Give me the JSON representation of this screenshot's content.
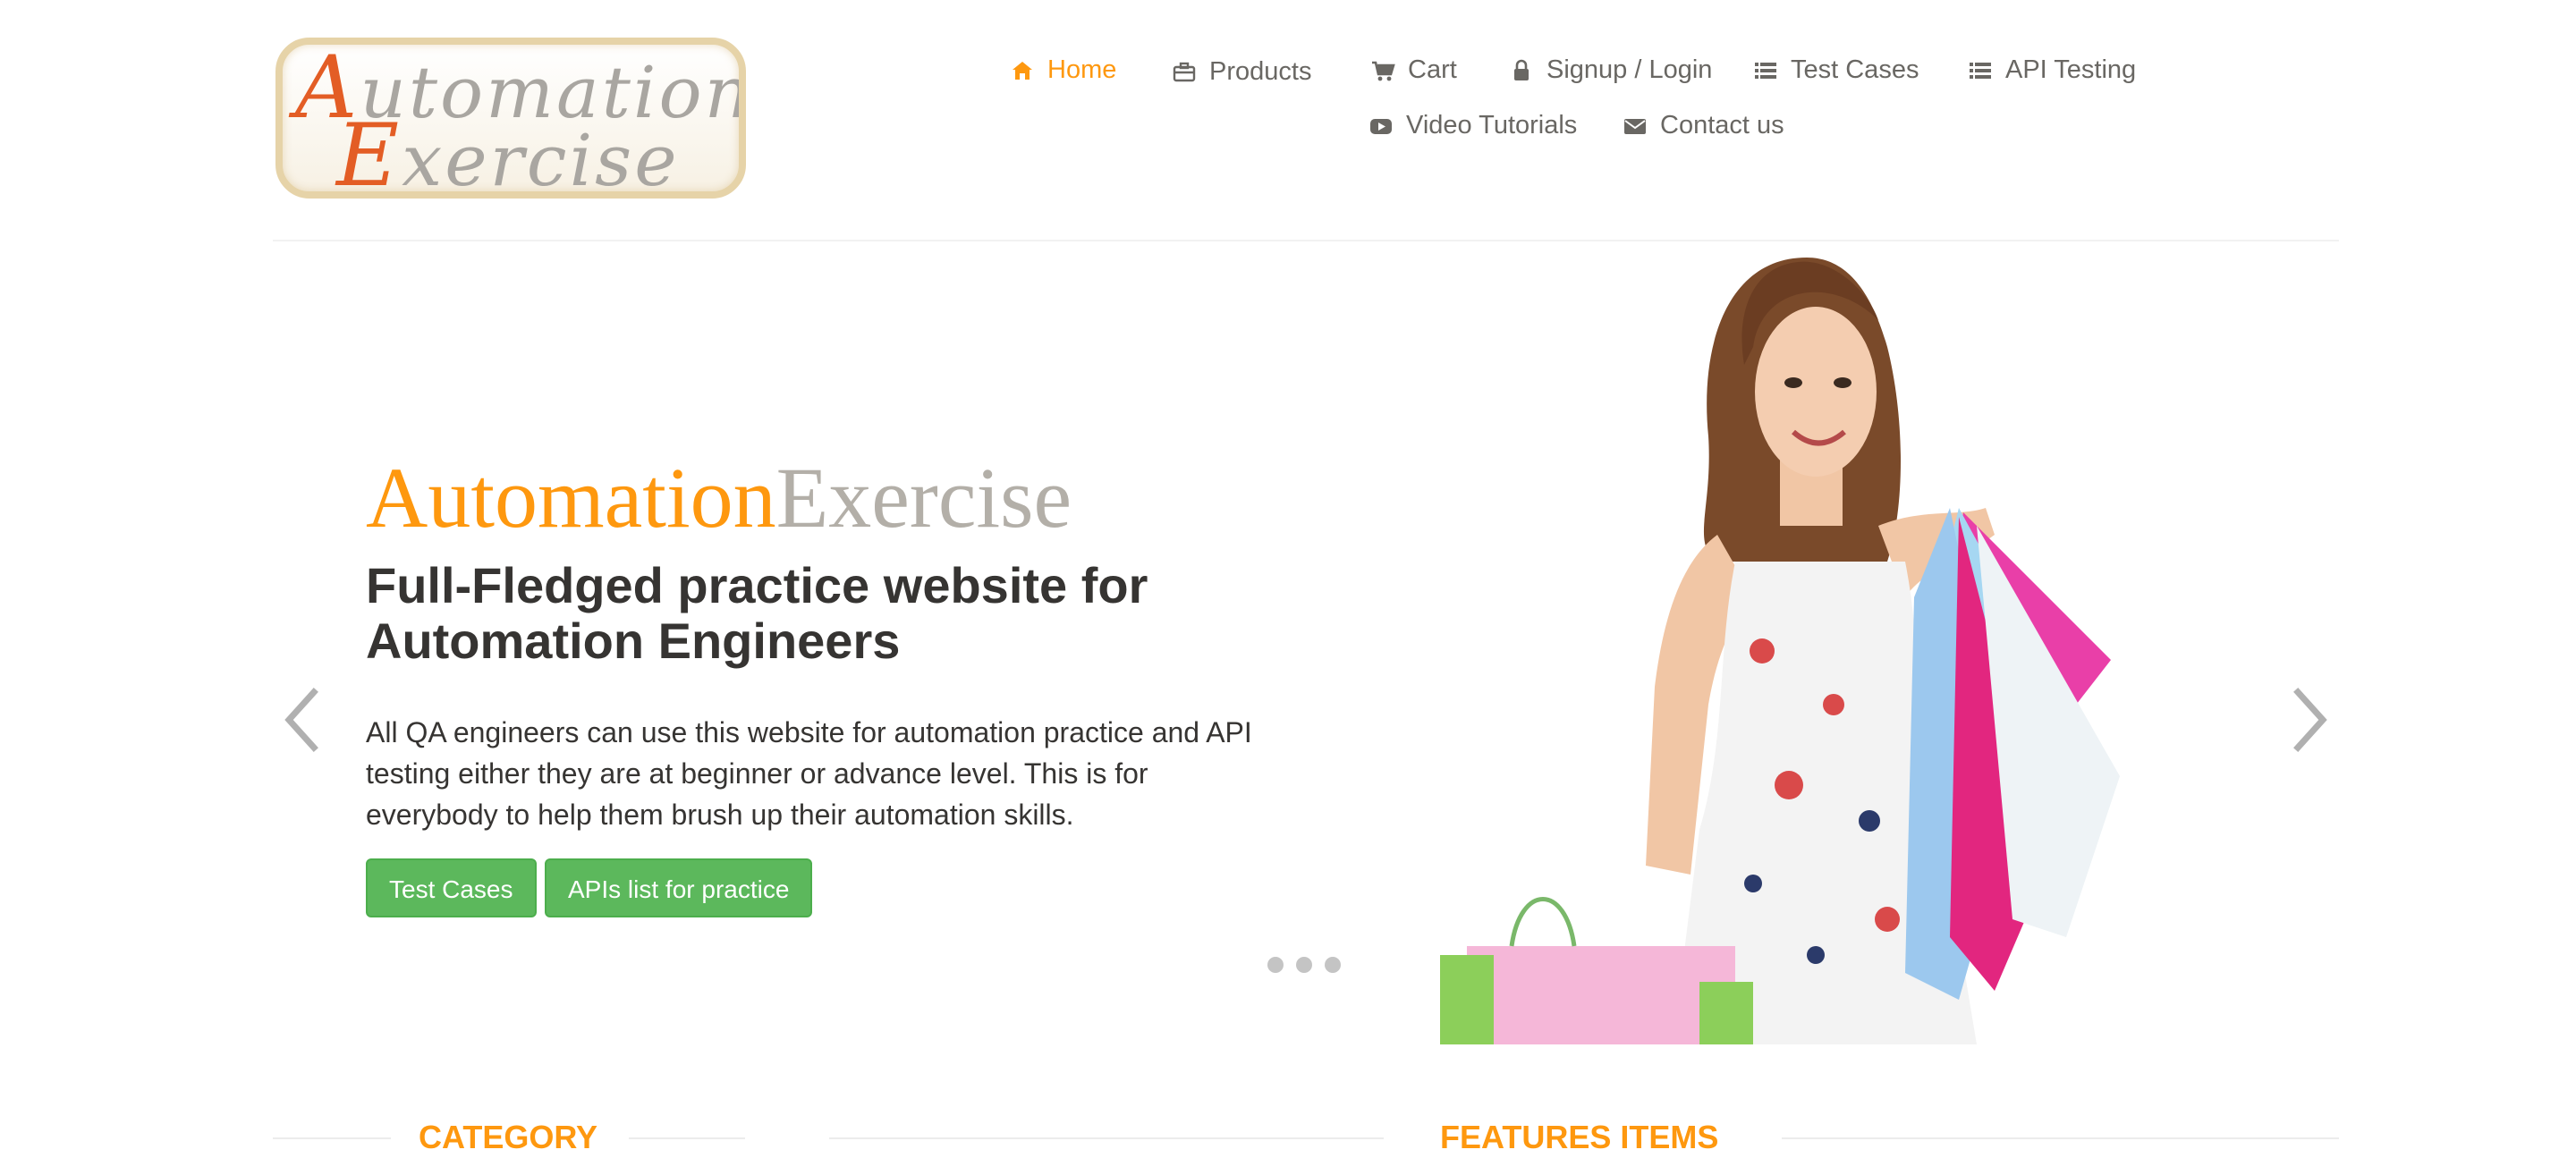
{
  "logo": {
    "line1_cap": "A",
    "line1_rest": "utomation",
    "line2_cap": "E",
    "line2_rest": "xercise"
  },
  "nav": {
    "items": [
      {
        "label": "Home",
        "icon": "home-icon",
        "active": true
      },
      {
        "label": "Products",
        "icon": "briefcase-icon"
      },
      {
        "label": "Cart",
        "icon": "cart-icon"
      },
      {
        "label": "Signup / Login",
        "icon": "lock-icon"
      },
      {
        "label": "Test Cases",
        "icon": "list-icon"
      },
      {
        "label": "API Testing",
        "icon": "list-icon"
      },
      {
        "label": "Video Tutorials",
        "icon": "youtube-play-icon"
      },
      {
        "label": "Contact us",
        "icon": "envelope-icon"
      }
    ]
  },
  "hero": {
    "title_part1": "Automation",
    "title_part2": "Exercise",
    "subtitle": "Full-Fledged practice website for Automation Engineers",
    "description": "All QA engineers can use this website for automation practice and API testing either they are at beginner or advance level. This is for everybody to help them brush up their automation skills.",
    "buttons": {
      "test_cases": "Test Cases",
      "apis_list": "APIs list for practice"
    },
    "carousel": {
      "slide_count": 3,
      "active_slide": 1
    }
  },
  "sections": {
    "category_title": "CATEGORY",
    "features_title": "FEATURES ITEMS"
  },
  "colors": {
    "accent": "#fe980f",
    "button_green": "#5cb85c",
    "text_dark": "#363432",
    "text_nav": "#696763",
    "title_gray": "#b3afa8"
  }
}
